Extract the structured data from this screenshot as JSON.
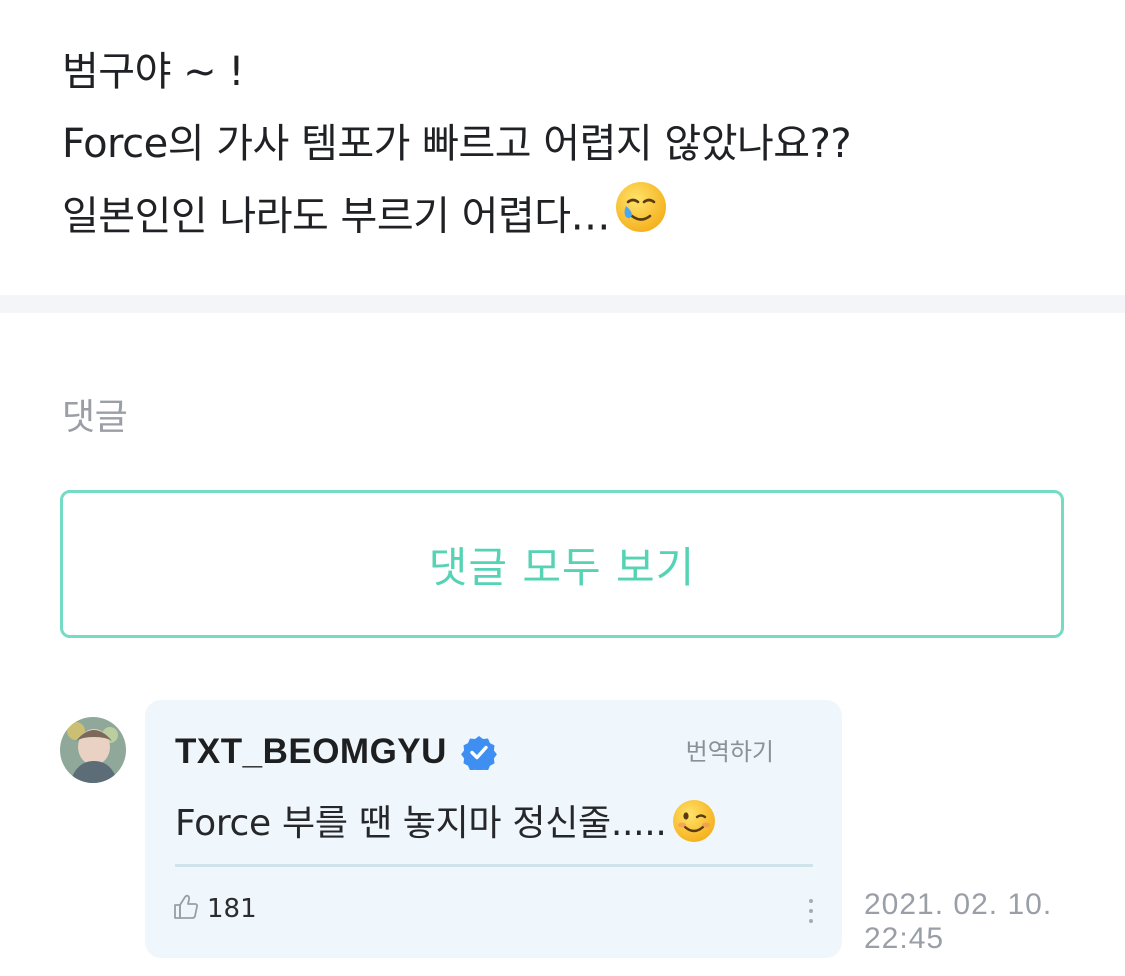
{
  "post": {
    "lines": [
      "범구야 ~ !",
      "Force의 가사 템포가 빠르고 어렵지 않았나요??",
      "일본인인 나라도 부르기 어렵다…"
    ],
    "trailing_emoji_icon": "smiling-face-with-tear-icon"
  },
  "comments": {
    "heading": "댓글",
    "view_all_label": "댓글 모두 보기",
    "accent_color": "#55d3b4",
    "items": [
      {
        "author": "TXT_BEOMGYU",
        "verified_icon": "verified-badge-icon",
        "translate_label": "번역하기",
        "text": "Force 부를 땐 놓지마 정신줄.....",
        "trailing_emoji_icon": "winking-face-icon",
        "likes": "181",
        "timestamp_date": "2021. 02. 10.",
        "timestamp_time": "22:45"
      }
    ]
  }
}
